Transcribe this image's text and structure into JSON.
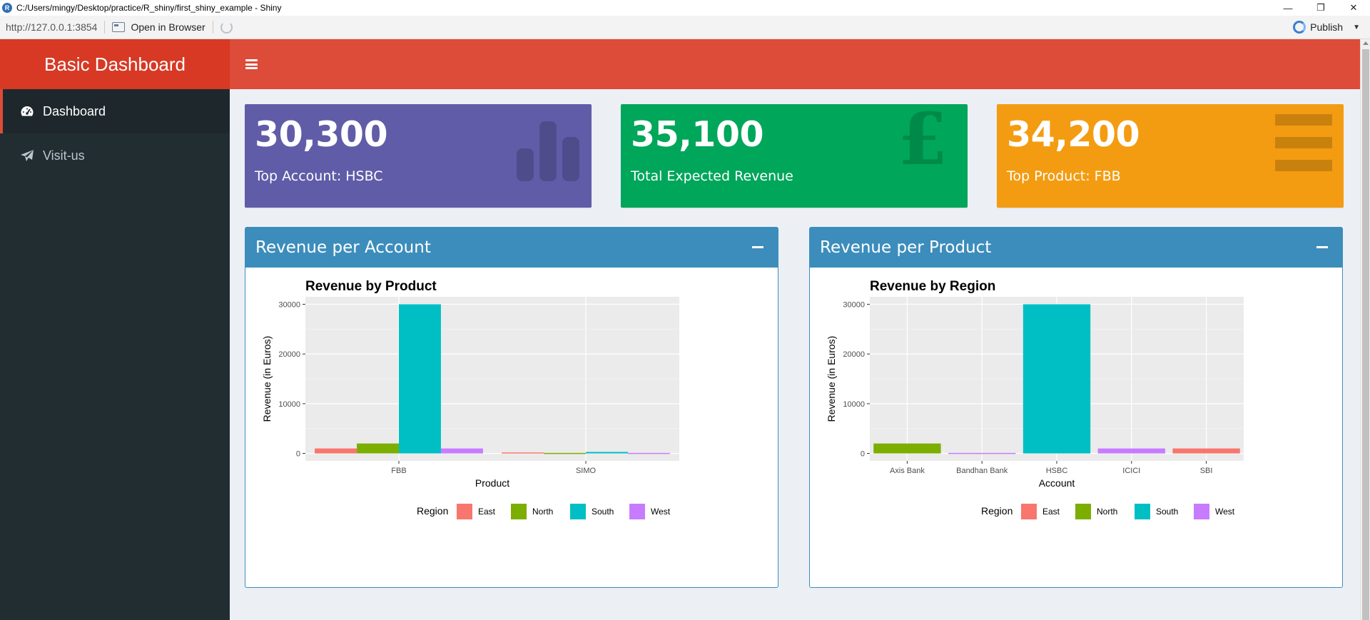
{
  "window": {
    "title": "C:/Users/mingy/Desktop/practice/R_shiny/first_shiny_example - Shiny",
    "minimize": "—",
    "restore": "❐",
    "close": "✕"
  },
  "toolbar": {
    "url": "http://127.0.0.1:3854",
    "open_in_browser": "Open in Browser",
    "publish": "Publish"
  },
  "header": {
    "title": "Basic Dashboard"
  },
  "sidebar": {
    "items": [
      {
        "label": "Dashboard",
        "icon": "dashboard-icon",
        "active": true
      },
      {
        "label": "Visit-us",
        "icon": "paper-plane-icon",
        "active": false
      }
    ]
  },
  "value_boxes": [
    {
      "value": "30,300",
      "subtitle": "Top Account: HSBC",
      "color": "#605ca8",
      "icon": "bar-chart-icon"
    },
    {
      "value": "35,100",
      "subtitle": "Total Expected Revenue",
      "color": "#00a65a",
      "icon": "pound-sign-icon"
    },
    {
      "value": "34,200",
      "subtitle": "Top Product: FBB",
      "color": "#f39c12",
      "icon": "menu-icon"
    }
  ],
  "boxes": [
    {
      "title": "Revenue per Account"
    },
    {
      "title": "Revenue per Product"
    }
  ],
  "colors": {
    "East": "#f8766d",
    "North": "#7cae00",
    "South": "#00bfc4",
    "West": "#c77cff",
    "box_header": "#3c8dbc",
    "navbar": "#dd4b39",
    "logo": "#d73925",
    "sidebar": "#222d32"
  },
  "chart_data": [
    {
      "type": "bar",
      "title": "Revenue by Product",
      "xlabel": "Product",
      "ylabel": "Revenue (in Euros)",
      "categories": [
        "FBB",
        "SIMO"
      ],
      "series": [
        {
          "name": "East",
          "values": [
            1000,
            200
          ]
        },
        {
          "name": "North",
          "values": [
            2000,
            100
          ]
        },
        {
          "name": "South",
          "values": [
            30000,
            300
          ]
        },
        {
          "name": "West",
          "values": [
            1000,
            100
          ]
        }
      ],
      "yticks": [
        0,
        10000,
        20000,
        30000
      ],
      "ylim": [
        -1500,
        31500
      ],
      "legend_title": "Region",
      "legend_position": "bottom",
      "grid": true
    },
    {
      "type": "bar",
      "title": "Revenue by Region",
      "xlabel": "Account",
      "ylabel": "Revenue (in Euros)",
      "categories": [
        "Axis Bank",
        "Bandhan Bank",
        "HSBC",
        "ICICI",
        "SBI"
      ],
      "series": [
        {
          "name": "East",
          "values": [
            0,
            0,
            0,
            0,
            1000
          ]
        },
        {
          "name": "North",
          "values": [
            2000,
            0,
            0,
            0,
            0
          ]
        },
        {
          "name": "South",
          "values": [
            0,
            0,
            30000,
            0,
            0
          ]
        },
        {
          "name": "West",
          "values": [
            0,
            100,
            0,
            1000,
            0
          ]
        }
      ],
      "bar_colors": [
        "#7cae00",
        "#c77cff",
        "#00bfc4",
        "#c77cff",
        "#f8766d"
      ],
      "yticks": [
        0,
        10000,
        20000,
        30000
      ],
      "ylim": [
        -1500,
        31500
      ],
      "legend_title": "Region",
      "legend_position": "bottom",
      "grid": true
    }
  ]
}
